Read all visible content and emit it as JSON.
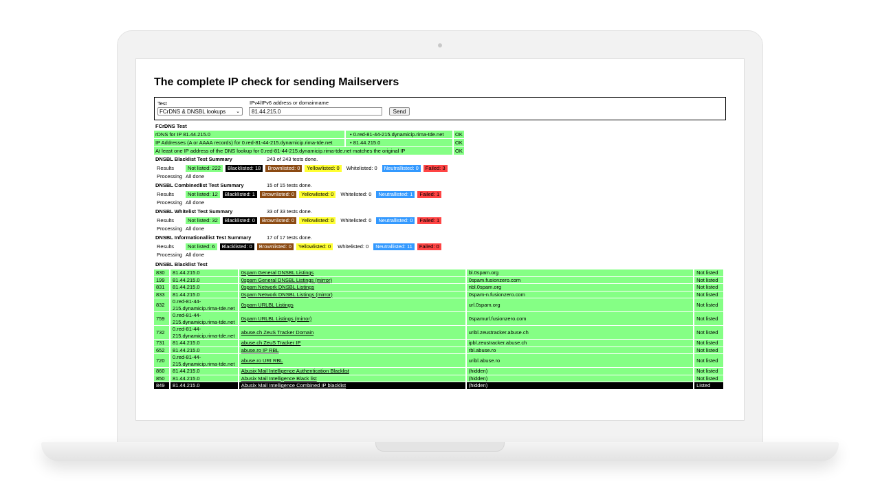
{
  "page": {
    "title": "The complete IP check for sending Mailservers"
  },
  "form": {
    "test_label": "Test",
    "test_value": "FCrDNS & DNSBL lookups",
    "address_label": "IPv4/IPv6 address or domainname",
    "address_value": "81.44.215.0",
    "send_label": "Send"
  },
  "fcrdns": {
    "title": "FCrDNS Test",
    "rows": [
      {
        "label": "rDNS for IP 81.44.215.0",
        "value": "0.red-81-44-215.dynamicip.rima-tde.net",
        "status": "OK"
      },
      {
        "label": "IP Addresses (A or AAAA records) for 0.red-81-44-215.dynamicip.rima-tde.net",
        "value": "81.44.215.0",
        "status": "OK"
      },
      {
        "label": "At least one IP address of the DNS lookup for 0.red-81-44-215.dynamicip.rima-tde.net matches the original IP",
        "value": "",
        "status": "OK"
      }
    ]
  },
  "summaries": [
    {
      "title": "DNSBL Blacklist Test Summary",
      "done": "243 of 243 tests done.",
      "results_label": "Results",
      "not_listed": "Not listed: 222",
      "blacklisted": "Blacklisted: 18",
      "brownlisted": "Brownlisted: 0",
      "yellowlisted": "Yellowlisted: 0",
      "whitelisted": "Whitelisted: 0",
      "neutrallisted": "Neutrallisted: 0",
      "failed": "Failed: 3",
      "processing_label": "Processing",
      "processing_value": "All done"
    },
    {
      "title": "DNSBL Combinedlist Test Summary",
      "done": "15 of 15 tests done.",
      "results_label": "Results",
      "not_listed": "Not listed: 12",
      "blacklisted": "Blacklisted: 1",
      "brownlisted": "Brownlisted: 0",
      "yellowlisted": "Yellowlisted: 0",
      "whitelisted": "Whitelisted: 0",
      "neutrallisted": "Neutrallisted: 1",
      "failed": "Failed: 1",
      "processing_label": "Processing",
      "processing_value": "All done"
    },
    {
      "title": "DNSBL Whitelist Test Summary",
      "done": "33 of 33 tests done.",
      "results_label": "Results",
      "not_listed": "Not listed: 32",
      "blacklisted": "Blacklisted: 0",
      "brownlisted": "Brownlisted: 0",
      "yellowlisted": "Yellowlisted: 0",
      "whitelisted": "Whitelisted: 0",
      "neutrallisted": "Neutrallisted: 0",
      "failed": "Failed: 1",
      "processing_label": "Processing",
      "processing_value": "All done"
    },
    {
      "title": "DNSBL Informationallist Test Summary",
      "done": "17 of 17 tests done.",
      "results_label": "Results",
      "not_listed": "Not listed: 6",
      "blacklisted": "Blacklisted: 0",
      "brownlisted": "Brownlisted: 0",
      "yellowlisted": "Yellowlisted: 0",
      "whitelisted": "Whitelisted: 0",
      "neutrallisted": "Neutrallisted: 11",
      "failed": "Failed: 0",
      "processing_label": "Processing",
      "processing_value": "All done"
    }
  ],
  "blacklist": {
    "title": "DNSBL Blacklist Test",
    "rows": [
      {
        "id": "830",
        "query": "81.44.215.0",
        "name": "0spam General DNSBL Listings",
        "zone": "bl.0spam.org",
        "status": "Not listed",
        "state": "nl"
      },
      {
        "id": "199",
        "query": "81.44.215.0",
        "name": "0spam General DNSBL Listings (mirror)",
        "zone": "0spam.fusionzero.com",
        "status": "Not listed",
        "state": "nl"
      },
      {
        "id": "831",
        "query": "81.44.215.0",
        "name": "0spam Network DNSBL Listings",
        "zone": "nbl.0spam.org",
        "status": "Not listed",
        "state": "nl"
      },
      {
        "id": "833",
        "query": "81.44.215.0",
        "name": "0spam Network DNSBL Listings (mirror)",
        "zone": "0spam-n.fusionzero.com",
        "status": "Not listed",
        "state": "nl"
      },
      {
        "id": "832",
        "query": "0.red-81-44-215.dynamicip.rima-tde.net",
        "name": "0spam URLBL Listings",
        "zone": "url.0spam.org",
        "status": "Not listed",
        "state": "nl"
      },
      {
        "id": "759",
        "query": "0.red-81-44-215.dynamicip.rima-tde.net",
        "name": "0spam URLBL Listings (mirror)",
        "zone": "0spamurl.fusionzero.com",
        "status": "Not listed",
        "state": "nl"
      },
      {
        "id": "732",
        "query": "0.red-81-44-215.dynamicip.rima-tde.net",
        "name": "abuse.ch ZeuS Tracker Domain",
        "zone": "uribl.zeustracker.abuse.ch",
        "status": "Not listed",
        "state": "nl"
      },
      {
        "id": "731",
        "query": "81.44.215.0",
        "name": "abuse.ch ZeuS Tracker IP",
        "zone": "ipbl.zeustracker.abuse.ch",
        "status": "Not listed",
        "state": "nl"
      },
      {
        "id": "652",
        "query": "81.44.215.0",
        "name": "abuse.ro IP RBL",
        "zone": "rbl.abuse.ro",
        "status": "Not listed",
        "state": "nl"
      },
      {
        "id": "720",
        "query": "0.red-81-44-215.dynamicip.rima-tde.net",
        "name": "abuse.ro URI RBL",
        "zone": "uribl.abuse.ro",
        "status": "Not listed",
        "state": "nl"
      },
      {
        "id": "860",
        "query": "81.44.215.0",
        "name": "Abusix Mail Intelligence Authentication Blacklist",
        "zone": "(hidden)",
        "status": "Not listed",
        "state": "nl"
      },
      {
        "id": "850",
        "query": "81.44.215.0",
        "name": "Abusix Mail Intelligence Black list",
        "zone": "(hidden)",
        "status": "Not listed",
        "state": "nl"
      },
      {
        "id": "849",
        "query": "81.44.215.0",
        "name": "Abusix Mail Intelligence Combined IP blacklist",
        "zone": "(hidden)",
        "status": "Listed",
        "state": "ls"
      }
    ]
  },
  "colors": {
    "not_listed": "#85ff85",
    "blacklisted": "#000000",
    "brownlisted": "#8b4a12",
    "yellowlisted": "#ffff33",
    "neutrallisted": "#3399ff",
    "failed": "#ff4444"
  }
}
